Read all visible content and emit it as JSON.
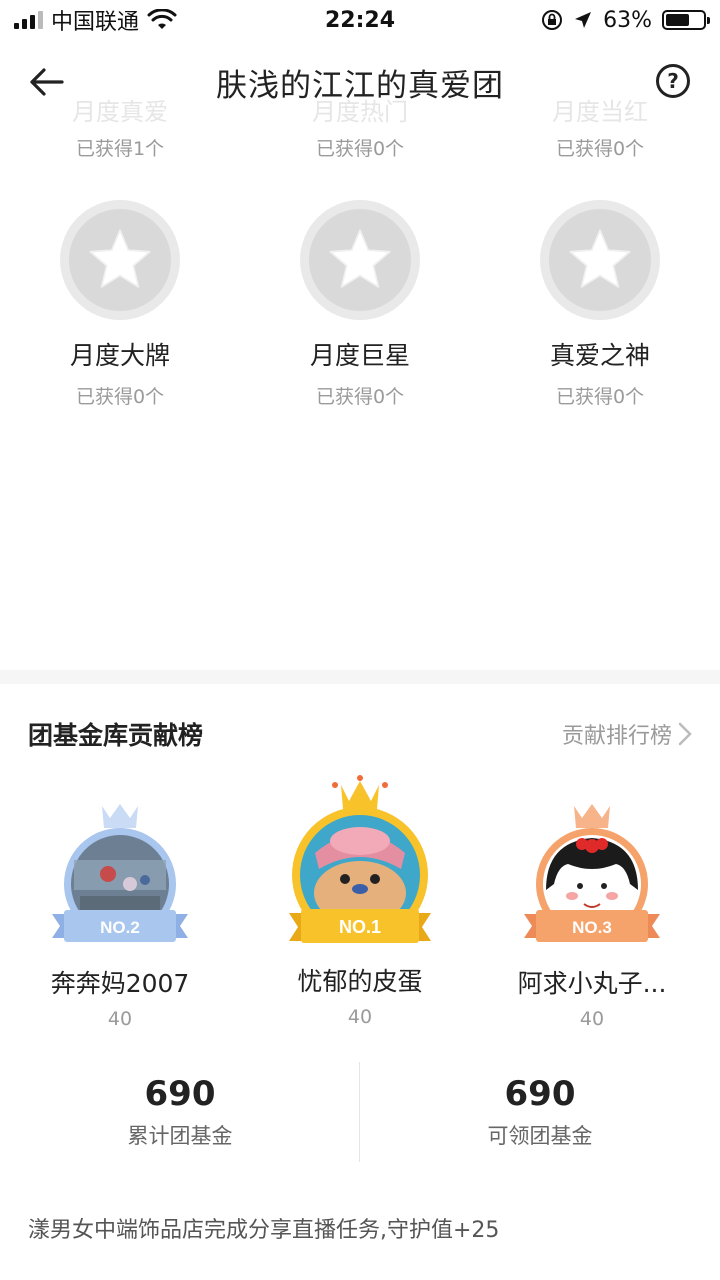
{
  "status_bar": {
    "carrier": "中国联通",
    "time": "22:24",
    "battery_percent": "63%",
    "battery_level": 0.63
  },
  "nav": {
    "title": "肤浅的江江的真爱团",
    "help_symbol": "?"
  },
  "faded_row": [
    "月度真爱",
    "月度热门",
    "月度当红"
  ],
  "top_badges_got": [
    "已获得1个",
    "已获得0个",
    "已获得0个"
  ],
  "badges": [
    {
      "name": "月度大牌",
      "got": "已获得0个"
    },
    {
      "name": "月度巨星",
      "got": "已获得0个"
    },
    {
      "name": "真爱之神",
      "got": "已获得0个"
    }
  ],
  "contrib": {
    "title": "团基金库贡献榜",
    "link_label": "贡献排行榜",
    "ranks": [
      {
        "badge": "NO.2",
        "name": "奔奔妈2007",
        "score": "40",
        "color": "#a9c6ee"
      },
      {
        "badge": "NO.1",
        "name": "忧郁的皮蛋",
        "score": "40",
        "color": "#f7c22a"
      },
      {
        "badge": "NO.3",
        "name": "阿求小丸子...",
        "score": "40",
        "color": "#f5a36b"
      }
    ]
  },
  "stats": [
    {
      "value": "690",
      "label": "累计团基金"
    },
    {
      "value": "690",
      "label": "可领团基金"
    }
  ],
  "activity_text": "漾男女中端饰品店完成分享直播任务,守护值+25",
  "colors": {
    "gold": "#f7c22a",
    "silver": "#a9c6ee",
    "bronze": "#f5a36b",
    "muted_text": "#9a9a9a"
  }
}
